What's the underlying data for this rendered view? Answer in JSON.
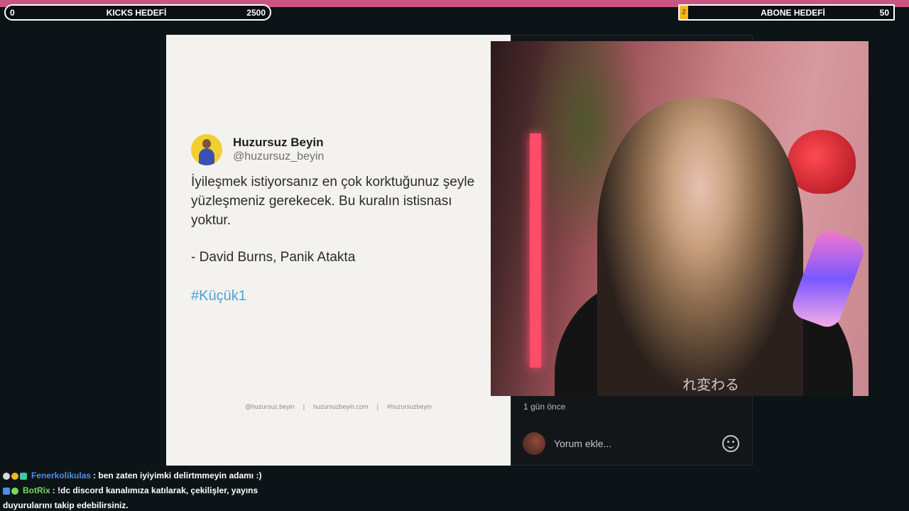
{
  "goals": {
    "kicks": {
      "start": "0",
      "title": "KICKS HEDEFİ",
      "end": "2500",
      "progress": 0.0
    },
    "abone": {
      "start": "2",
      "title": "ABONE HEDEFİ",
      "end": "50",
      "progress": 0.04
    }
  },
  "post": {
    "author_name": "Huzursuz Beyin",
    "handle": "@huzursuz_beyin",
    "text": "İyileşmek istiyorsanız en çok korktuğunuz şeyle yüzleşmeniz gerekecek. Bu kuralın istisnası yoktur.",
    "quote_author": "- David Burns, Panik Atakta",
    "hashtag": "#Küçük1",
    "footer": [
      "@huzursuz.beyin",
      "huzursuzbeyin.com",
      "#huzursuzbeyin"
    ]
  },
  "side": {
    "time": "1 gün önce",
    "comment_placeholder": "Yorum ekle..."
  },
  "cam": {
    "overlay_text": "れ変わる"
  },
  "chat": {
    "messages": [
      {
        "user": "Fenerkolikulas",
        "text": ": ben zaten iyiyimki delirtmmeyin adamı :)",
        "color": "#4f8ee0"
      },
      {
        "user": "BotRix",
        "text": ": !dc discord kanalımıza katılarak, çekilişler, yayıns",
        "continuation": "duyurularını takip edebilirsiniz.",
        "color": "#79d85f"
      }
    ]
  },
  "colors": {
    "accent_strip": "#c8567f",
    "goal_fill": "#f3b61f",
    "hashtag": "#4aa3d6"
  }
}
